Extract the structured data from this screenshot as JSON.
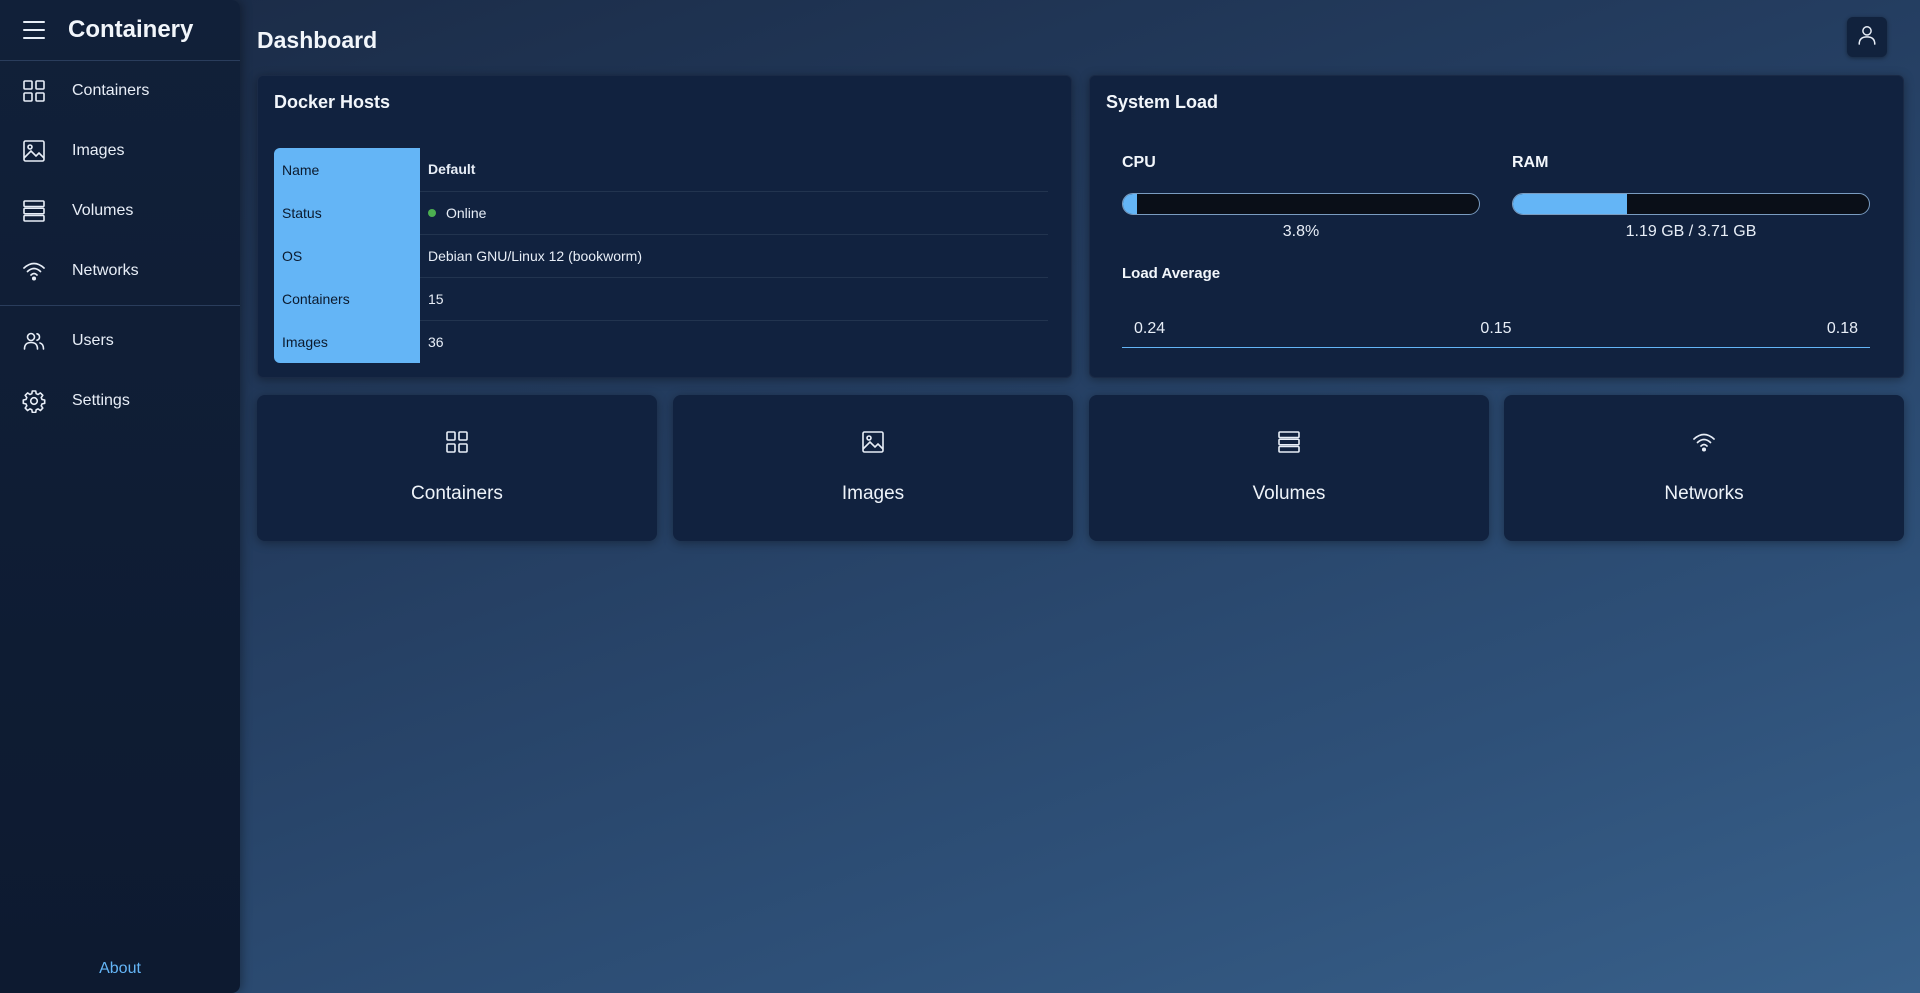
{
  "app": {
    "title": "Containery"
  },
  "sidebar": {
    "items": [
      {
        "label": "Containers",
        "icon": "grid-icon"
      },
      {
        "label": "Images",
        "icon": "image-icon"
      },
      {
        "label": "Volumes",
        "icon": "stack-icon"
      },
      {
        "label": "Networks",
        "icon": "wifi-icon"
      }
    ],
    "secondary": [
      {
        "label": "Users",
        "icon": "users-icon"
      },
      {
        "label": "Settings",
        "icon": "gear-icon"
      }
    ],
    "about": "About"
  },
  "header": {
    "title": "Dashboard"
  },
  "docker_hosts": {
    "title": "Docker Hosts",
    "rows": [
      {
        "key": "Name",
        "value": "Default"
      },
      {
        "key": "Status",
        "value": "Online"
      },
      {
        "key": "OS",
        "value": "Debian GNU/Linux 12 (bookworm)"
      },
      {
        "key": "Containers",
        "value": "15"
      },
      {
        "key": "Images",
        "value": "36"
      }
    ]
  },
  "system_load": {
    "title": "System Load",
    "cpu": {
      "label": "CPU",
      "value_text": "3.8%",
      "percent": 3.8
    },
    "ram": {
      "label": "RAM",
      "value_text": "1.19 GB / 3.71 GB",
      "percent": 32.1
    },
    "load_average": {
      "label": "Load Average",
      "values": [
        "0.24",
        "0.15",
        "0.18"
      ]
    }
  },
  "tiles": [
    {
      "label": "Containers",
      "icon": "grid-icon"
    },
    {
      "label": "Images",
      "icon": "image-icon"
    },
    {
      "label": "Volumes",
      "icon": "stack-icon"
    },
    {
      "label": "Networks",
      "icon": "wifi-icon"
    }
  ],
  "colors": {
    "accent": "#64b5f6",
    "online": "#4caf50"
  }
}
